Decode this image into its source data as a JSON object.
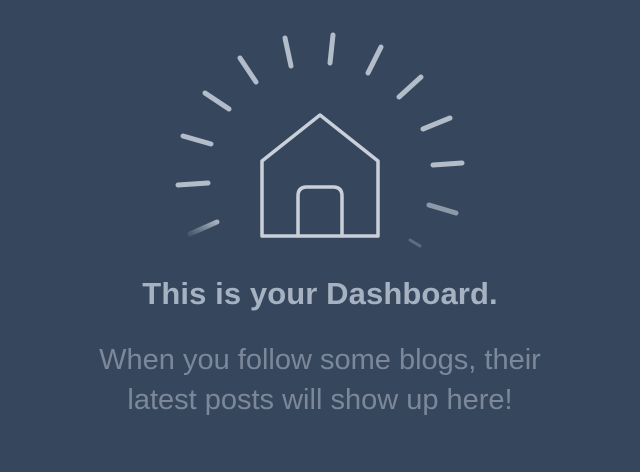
{
  "dashboard": {
    "title": "This is your Dashboard.",
    "message_line1": "When you follow some blogs, their",
    "message_line2": "latest posts will show up here!"
  },
  "icons": {
    "illustration": "house-icon",
    "rays": "sunburst-rays"
  },
  "colors": {
    "background": "#36465d",
    "title": "#a6b1c1",
    "message": "#7c8899",
    "icon_stroke": "#c9d0da",
    "ray": "#b3bcc9"
  }
}
